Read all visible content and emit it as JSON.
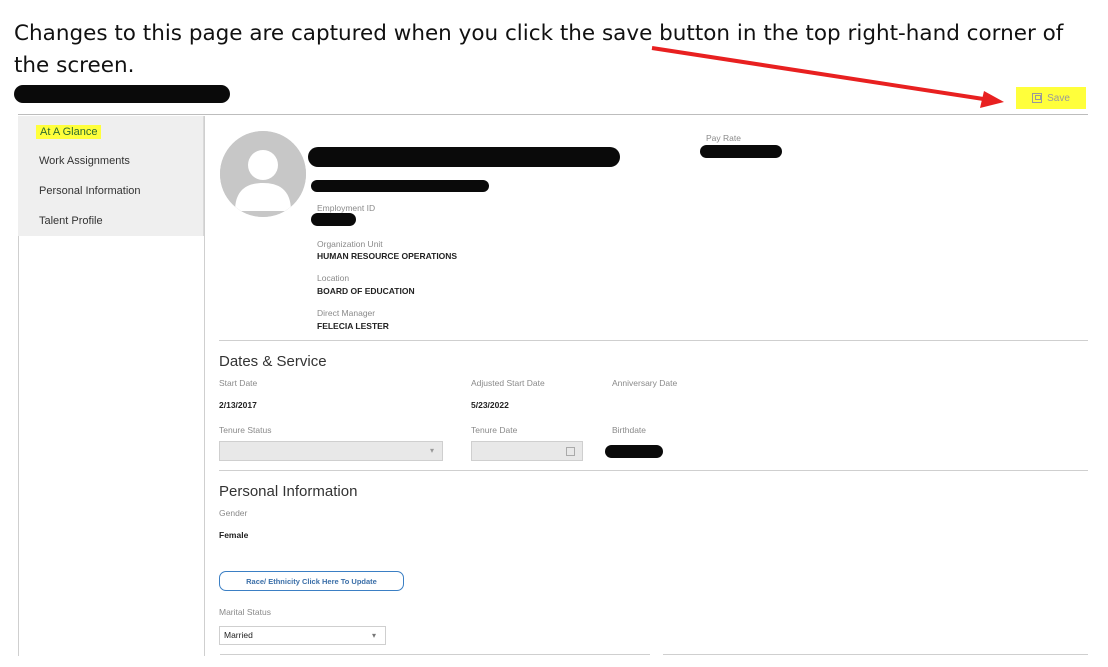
{
  "caption": "Changes to this page are captured when you click the save button in the top right-hand corner of the screen.",
  "header": {
    "save_label": "Save"
  },
  "sidebar": {
    "items": [
      {
        "label": "At A Glance",
        "active": true
      },
      {
        "label": "Work Assignments"
      },
      {
        "label": "Personal Information"
      },
      {
        "label": "Talent Profile"
      }
    ]
  },
  "profile": {
    "pay_rate_label": "Pay Rate",
    "employment_id_label": "Employment ID",
    "org_unit_label": "Organization Unit",
    "org_unit_value": "HUMAN RESOURCE OPERATIONS",
    "location_label": "Location",
    "location_value": "BOARD OF EDUCATION",
    "manager_label": "Direct Manager",
    "manager_value": "FELECIA LESTER"
  },
  "dates": {
    "title": "Dates & Service",
    "start_date_label": "Start Date",
    "start_date_value": "2/13/2017",
    "adjusted_start_label": "Adjusted Start Date",
    "adjusted_start_value": "5/23/2022",
    "anniversary_label": "Anniversary Date",
    "tenure_status_label": "Tenure Status",
    "tenure_date_label": "Tenure Date",
    "birthdate_label": "Birthdate"
  },
  "personal": {
    "title": "Personal Information",
    "gender_label": "Gender",
    "gender_value": "Female",
    "race_button_label": "Race/ Ethnicity Click Here To Update",
    "marital_label": "Marital Status",
    "marital_value": "Married"
  },
  "colors": {
    "highlight": "#ffff3b",
    "arrow": "#e82020",
    "accent_blue": "#3b7fc4"
  }
}
